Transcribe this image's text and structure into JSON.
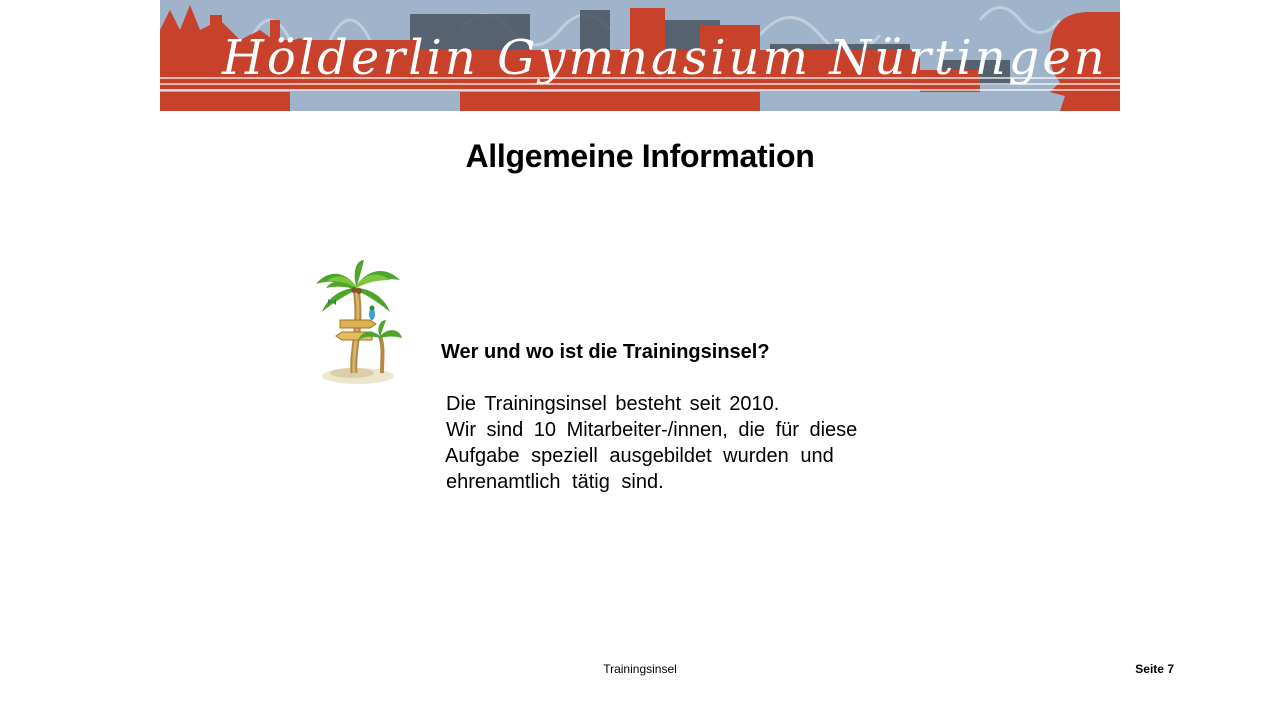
{
  "banner": {
    "text": "Hölderlin Gymnasium Nürtingen",
    "colors": {
      "sky": "#9fb3cb",
      "red": "#c8412a",
      "dark": "#4a5360",
      "script": "#ffffff"
    }
  },
  "slide": {
    "title": "Allgemeine Information",
    "heading": "Wer und wo ist die Trainingsinsel?",
    "body_lines": [
      "Die Trainingsinsel besteht seit 2010.",
      "Wir sind 10 Mitarbeiter-/innen, die für diese",
      "Aufgabe speziell ausgebildet wurden und",
      "ehrenamtlich tätig sind."
    ]
  },
  "illustration": {
    "icon": "palm-tree-signpost-icon"
  },
  "footer": {
    "center_text": "Trainingsinsel",
    "page_label": "Seite 7"
  }
}
